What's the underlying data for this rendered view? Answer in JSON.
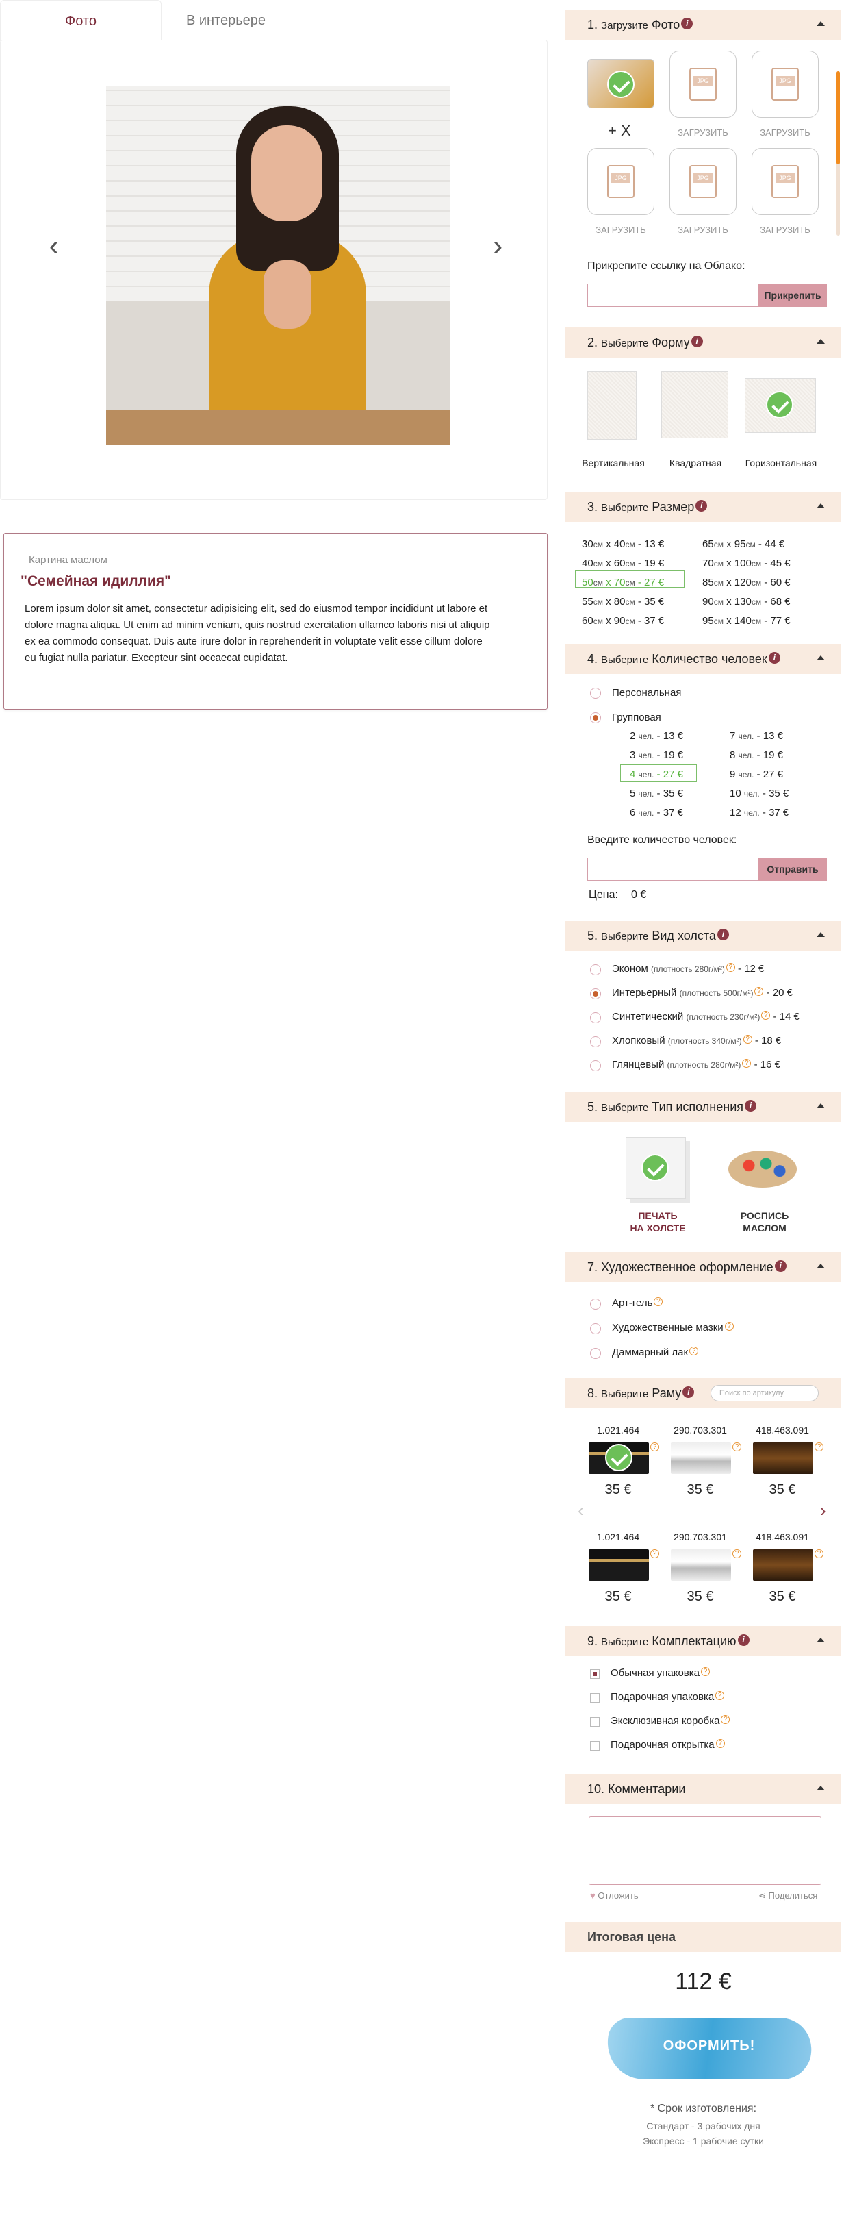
{
  "tabs": {
    "photo": "Фото",
    "interior": "В интерьере"
  },
  "gallery": {
    "prev": "‹",
    "next": "›"
  },
  "description": {
    "small": "Картина маслом",
    "title": "\"Семейная идиллия\"",
    "text": "Lorem ipsum dolor sit amet, consectetur adipisicing elit, sed do eiusmod tempor incididunt ut labore et dolore magna aliqua. Ut enim ad minim veniam, quis nostrud exercitation ullamco laboris nisi ut aliquip ex ea commodo consequat. Duis aute irure dolor in reprehenderit in voluptate velit esse cillum dolore eu fugiat nulla pariatur. Excepteur sint occaecat cupidatat."
  },
  "s1": {
    "num": "1.",
    "pre": "Загрузите",
    "title": "Фото",
    "info": "i",
    "plusx": "+ X",
    "upload": "ЗАГРУЗИТЬ",
    "jpg": "JPG",
    "cloud_label": "Прикрепите ссылку на Облако:",
    "cloud_btn": "Прикрепить"
  },
  "s2": {
    "num": "2.",
    "pre": "Выберите",
    "title": "Форму",
    "shapes": [
      "Вертикальная",
      "Квадратная",
      "Горизонтальная"
    ]
  },
  "s3": {
    "num": "3.",
    "pre": "Выберите",
    "title": "Размер",
    "sizes_left": [
      "30",
      "40",
      "13"
    ],
    "rows": [
      {
        "a": "30",
        "b": "40",
        "p": "13",
        "c": "65",
        "d": "95",
        "q": "44"
      },
      {
        "a": "40",
        "b": "60",
        "p": "19",
        "c": "70",
        "d": "100",
        "q": "45"
      },
      {
        "a": "50",
        "b": "70",
        "p": "27",
        "c": "85",
        "d": "120",
        "q": "60"
      },
      {
        "a": "55",
        "b": "80",
        "p": "35",
        "c": "90",
        "d": "130",
        "q": "68"
      },
      {
        "a": "60",
        "b": "90",
        "p": "37",
        "c": "95",
        "d": "140",
        "q": "77"
      }
    ],
    "cm": "см",
    "x": "х",
    "euro": "€"
  },
  "s4": {
    "num": "4.",
    "pre": "Выберите",
    "title": "Количество человек",
    "personal": "Персональная",
    "group": "Групповая",
    "people": [
      {
        "n": "2",
        "p": "13",
        "n2": "7",
        "p2": "13"
      },
      {
        "n": "3",
        "p": "19",
        "n2": "8",
        "p2": "19"
      },
      {
        "n": "4",
        "p": "27",
        "n2": "9",
        "p2": "27"
      },
      {
        "n": "5",
        "p": "35",
        "n2": "10",
        "p2": "35"
      },
      {
        "n": "6",
        "p": "37",
        "n2": "12",
        "p2": "37"
      }
    ],
    "unit": "чел.",
    "enter_label": "Введите количество человек:",
    "send_btn": "Отправить",
    "price_label": "Цена:",
    "price_value": "0 €"
  },
  "s5": {
    "num": "5.",
    "pre": "Выберите",
    "title": "Вид холста",
    "items": [
      {
        "name": "Эконом",
        "density": "(плотность 280г/м²)",
        "price": "- 12 €"
      },
      {
        "name": "Интерьерный",
        "density": "(плотность 500г/м²)",
        "price": "- 20 €"
      },
      {
        "name": "Синтетический",
        "density": "(плотность 230г/м²)",
        "price": "- 14 €"
      },
      {
        "name": "Хлопковый",
        "density": "(плотность 340г/м²)",
        "price": "- 18 €"
      },
      {
        "name": "Глянцевый",
        "density": "(плотность 280г/м²)",
        "price": "- 16 €"
      }
    ]
  },
  "s6": {
    "num": "5.",
    "pre": "Выберите",
    "title": "Тип исполнения",
    "print1": "ПЕЧАТЬ",
    "print2": "НА ХОЛСТЕ",
    "paint1": "РОСПИСЬ",
    "paint2": "МАСЛОМ"
  },
  "s7": {
    "title": "7. Художественное оформление",
    "items": [
      "Арт-гель",
      "Художественные мазки",
      "Даммарный лак"
    ]
  },
  "s8": {
    "num": "8.",
    "pre": "Выберите",
    "title": "Раму",
    "search": "Поиск по артикулу",
    "codes": [
      "1.021.464",
      "290.703.301",
      "418.463.091"
    ],
    "price": "35 €"
  },
  "s9": {
    "num": "9.",
    "pre": "Выберите",
    "title": "Комплектацию",
    "items": [
      "Обычная упаковка",
      "Подарочная  упаковка",
      "Эксклюзивная коробка",
      "Подарочная открытка"
    ]
  },
  "s10": {
    "title": "10. Комментарии",
    "postpone": "Отложить",
    "share": "Поделиться"
  },
  "total": {
    "title": "Итоговая цена",
    "price": "112 €",
    "order": "ОФОРМИТЬ!",
    "term_title": "* Срок изготовления:",
    "term1": "Стандарт - 3 рабочих дня",
    "term2": "Экспресс - 1 рабочие сутки"
  },
  "colors": {
    "accent": "#7b2c3a",
    "section_bg": "#f9ebe0",
    "green": "#55b23b",
    "orange": "#f28c1e"
  }
}
